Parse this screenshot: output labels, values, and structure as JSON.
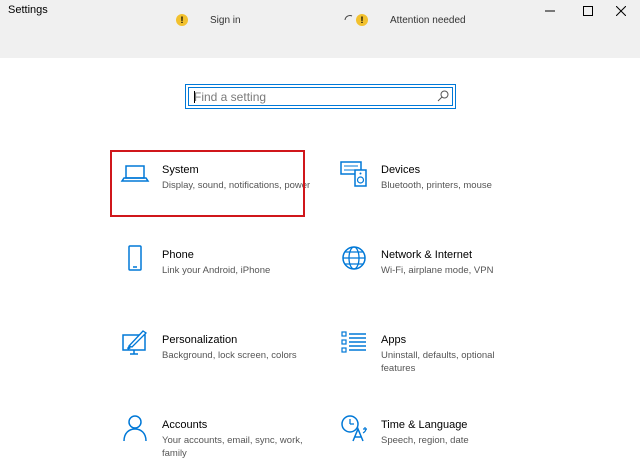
{
  "window": {
    "title": "Settings"
  },
  "header": {
    "sign_in_label": "Sign in",
    "attention_label": "Attention needed",
    "warning_glyph": "!"
  },
  "search": {
    "placeholder": "Find a setting",
    "icon": "search-icon"
  },
  "categories": [
    {
      "title": "System",
      "desc": "Display, sound, notifications, power",
      "icon": "laptop-icon",
      "selected": true
    },
    {
      "title": "Devices",
      "desc": "Bluetooth, printers, mouse",
      "icon": "keyboard-speaker-icon"
    },
    {
      "title": "Phone",
      "desc": "Link your Android, iPhone",
      "icon": "phone-icon"
    },
    {
      "title": "Network & Internet",
      "desc": "Wi-Fi, airplane mode, VPN",
      "icon": "globe-icon"
    },
    {
      "title": "Personalization",
      "desc": "Background, lock screen, colors",
      "icon": "paint-monitor-icon"
    },
    {
      "title": "Apps",
      "desc": "Uninstall, defaults, optional features",
      "icon": "apps-list-icon"
    },
    {
      "title": "Accounts",
      "desc": "Your accounts, email, sync, work, family",
      "icon": "person-icon"
    },
    {
      "title": "Time & Language",
      "desc": "Speech, region, date",
      "icon": "time-language-icon"
    }
  ],
  "colors": {
    "accent": "#0078d7",
    "highlight": "#d0171b",
    "warning": "#f2c12e"
  }
}
